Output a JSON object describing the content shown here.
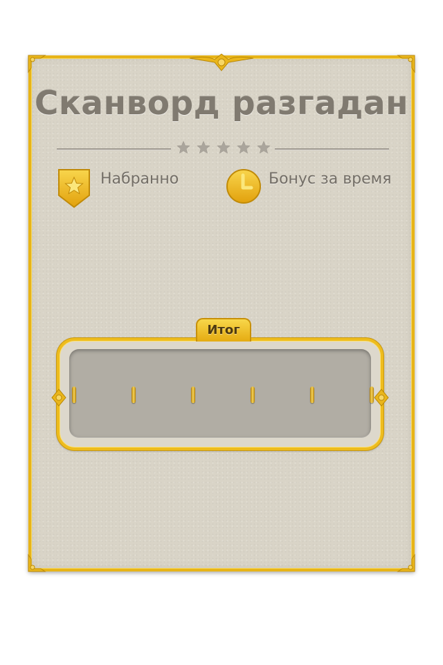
{
  "dialog": {
    "title": "Сканворд разгадан",
    "stars_total": 5,
    "stats": {
      "score_label": "Набранно",
      "score_icon": "star-badge-icon",
      "time_bonus_label": "Бонус за время",
      "time_bonus_icon": "clock-icon"
    },
    "result": {
      "tab_label": "Итог",
      "digit_slots": 6
    }
  },
  "colors": {
    "gold": "#e7b418",
    "paper": "#d9d4c7",
    "title_text": "#807a70",
    "panel": "#b1ada4"
  }
}
